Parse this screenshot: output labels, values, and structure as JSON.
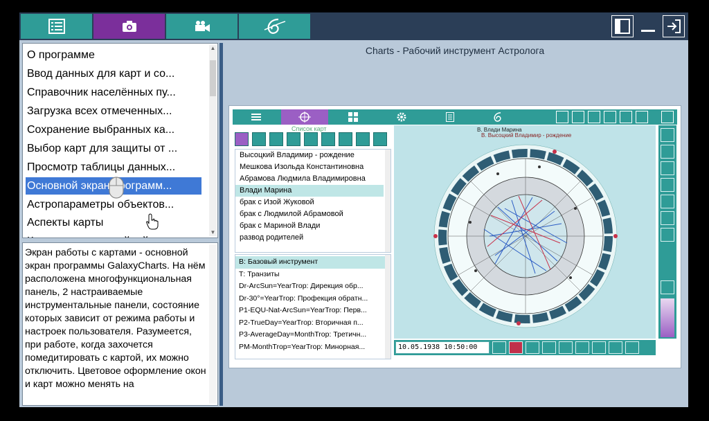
{
  "topbar": {
    "tabs": [
      {
        "name": "tab-list",
        "icon": "list-icon",
        "color": "#2f9c97"
      },
      {
        "name": "tab-camera",
        "icon": "camera-icon",
        "color": "#7b2f9b"
      },
      {
        "name": "tab-video",
        "icon": "video-camera-icon",
        "color": "#2f9c97"
      },
      {
        "name": "tab-logo",
        "icon": "galaxy-logo-icon",
        "color": "#2f9c97"
      }
    ],
    "right_buttons": [
      "panel-toggle-icon",
      "minimize-icon",
      "exit-icon"
    ]
  },
  "menu": {
    "items": [
      "О программе",
      "Ввод данных для карт и со...",
      "Справочник населённых пу...",
      "Загрузка всех отмеченных...",
      "Сохранение выбранных ка...",
      "Выбор карт для защиты от ...",
      "Просмотр таблицы данных...",
      "Основной экран программ...",
      "Астропараметры объектов...",
      "Аспекты карты",
      "Кросс-аспекты двойной ка..."
    ],
    "selected_index": 7
  },
  "description": "Экран работы с картами - основной экран программы GalaxyCharts. На нём расположена многофункциональная панель, 2 настраиваемые инструментальные панели, состояние которых зависит от режима работы и настроек пользователя. Разумеется, при работе, когда захочется помедитировать с картой, их можно отключить. Цветовое оформление окон и карт можно менять на",
  "right": {
    "title": "Charts - Рабочий инструмент Астролога"
  },
  "inner": {
    "list_title": "Список карт",
    "charts": [
      "Высоцкий Владимир - рождение",
      "Мешкова Изольда Константиновна",
      "Абрамова Людмила Владимировна",
      "Влади Марина",
      "брак с Изой Жуковой",
      "брак с Людмилой Абрамовой",
      "брак с Мариной Влади",
      "развод родителей"
    ],
    "charts_selected_index": 3,
    "techniques": [
      "В: Базовый инструмент",
      "Т: Транзиты",
      "Dr-ArcSun=YearTrop: Дирекция обр...",
      "Dr-30°=YearTrop: Профекция обратн...",
      "P1-EQU-Nat-ArcSun=YearTrop: Перв...",
      "P2-TrueDay=YearTrop: Вторичная п...",
      "P3-AverageDay=MonthTrop: Третичн...",
      "PM-MonthTrop=YearTrop: Минорная..."
    ],
    "techniques_selected_index": 0,
    "chart_header_1": "В. Влади Марина",
    "chart_header_2": "В. Высоцкий Владимир - рождение",
    "datetime": "10.05.1938 10:50:00"
  }
}
